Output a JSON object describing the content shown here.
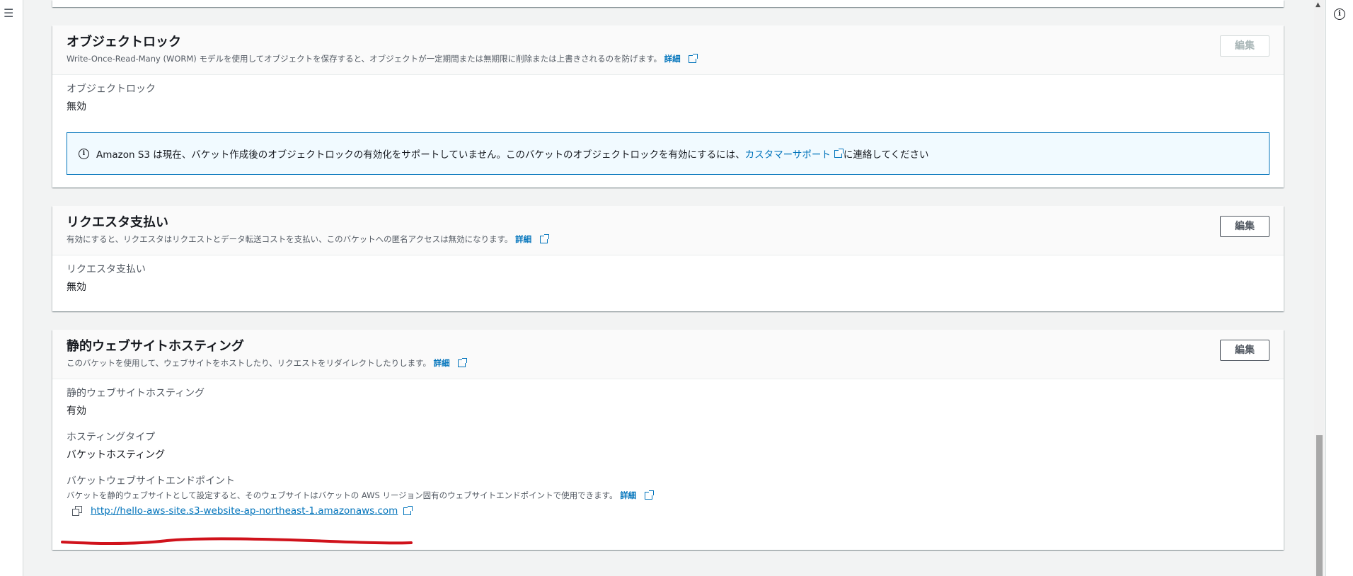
{
  "nav": {
    "menu_icon": "hamburger-icon",
    "info_icon": "info-icon"
  },
  "panels": {
    "object_lock": {
      "title": "オブジェクトロック",
      "description": "Write-Once-Read-Many (WORM) モデルを使用してオブジェクトを保存すると、オブジェクトが一定期間または無期限に削除または上書きされるのを防げます。",
      "info_link": "詳細",
      "edit_label": "編集",
      "field_label": "オブジェクトロック",
      "field_value": "無効",
      "alert": {
        "text_before": "Amazon S3 は現在、バケット作成後のオブジェクトロックの有効化をサポートしていません。このバケットのオブジェクトロックを有効にするには、",
        "link_text": "カスタマーサポート",
        "text_after": "に連絡してください"
      }
    },
    "requester_pays": {
      "title": "リクエスタ支払い",
      "description": "有効にすると、リクエスタはリクエストとデータ転送コストを支払い、このバケットへの匿名アクセスは無効になります。",
      "info_link": "詳細",
      "edit_label": "編集",
      "field_label": "リクエスタ支払い",
      "field_value": "無効"
    },
    "static_hosting": {
      "title": "静的ウェブサイトホスティング",
      "description": "このバケットを使用して、ウェブサイトをホストしたり、リクエストをリダイレクトしたりします。",
      "info_link": "詳細",
      "edit_label": "編集",
      "status_label": "静的ウェブサイトホスティング",
      "status_value": "有効",
      "type_label": "ホスティングタイプ",
      "type_value": "バケットホスティング",
      "endpoint_label": "バケットウェブサイトエンドポイント",
      "endpoint_desc": "バケットを静的ウェブサイトとして設定すると、そのウェブサイトはバケットの AWS リージョン固有のウェブサイトエンドポイントで使用できます。",
      "endpoint_info_link": "詳細",
      "endpoint_url": "http://hello-aws-site.s3-website-ap-northeast-1.amazonaws.com"
    }
  },
  "colors": {
    "link": "#0073bb",
    "annotation": "#d0121b",
    "background": "#f2f3f3"
  }
}
